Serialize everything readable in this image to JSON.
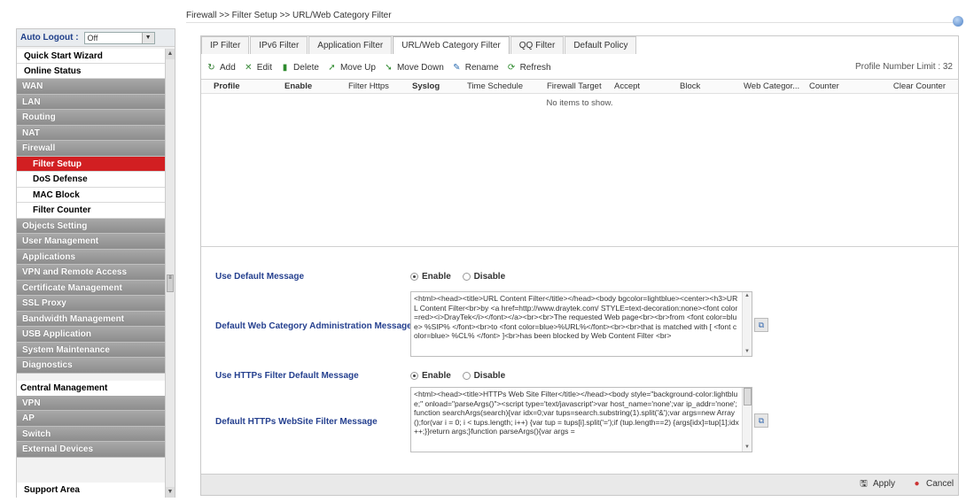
{
  "breadcrumb": "Firewall >> Filter Setup >> URL/Web Category Filter",
  "sidebar": {
    "auto_logout_label": "Auto Logout :",
    "auto_logout_value": "Off",
    "menu": [
      {
        "label": "Quick Start Wizard",
        "style": "top"
      },
      {
        "label": "Online Status",
        "style": "top"
      },
      {
        "label": "WAN",
        "style": "dark"
      },
      {
        "label": "LAN",
        "style": "dark"
      },
      {
        "label": "Routing",
        "style": "dark"
      },
      {
        "label": "NAT",
        "style": "dark"
      },
      {
        "label": "Firewall",
        "style": "dark"
      },
      {
        "label": "Filter Setup",
        "style": "sub-active"
      },
      {
        "label": "DoS Defense",
        "style": "sub"
      },
      {
        "label": "MAC Block",
        "style": "sub"
      },
      {
        "label": "Filter Counter",
        "style": "sub"
      },
      {
        "label": "Objects Setting",
        "style": "dark"
      },
      {
        "label": "User Management",
        "style": "dark"
      },
      {
        "label": "Applications",
        "style": "dark"
      },
      {
        "label": "VPN and Remote Access",
        "style": "dark"
      },
      {
        "label": "Certificate Management",
        "style": "dark"
      },
      {
        "label": "SSL Proxy",
        "style": "dark"
      },
      {
        "label": "Bandwidth Management",
        "style": "dark"
      },
      {
        "label": "USB Application",
        "style": "dark"
      },
      {
        "label": "System Maintenance",
        "style": "dark"
      },
      {
        "label": "Diagnostics",
        "style": "dark"
      },
      {
        "label": "Central Management",
        "style": "section"
      },
      {
        "label": "VPN",
        "style": "dark"
      },
      {
        "label": "AP",
        "style": "dark"
      },
      {
        "label": "Switch",
        "style": "dark"
      },
      {
        "label": "External Devices",
        "style": "dark"
      }
    ],
    "support_area": "Support Area"
  },
  "tabs": [
    {
      "label": "IP Filter",
      "active": false
    },
    {
      "label": "IPv6 Filter",
      "active": false
    },
    {
      "label": "Application Filter",
      "active": false
    },
    {
      "label": "URL/Web Category Filter",
      "active": true
    },
    {
      "label": "QQ Filter",
      "active": false
    },
    {
      "label": "Default Policy",
      "active": false
    }
  ],
  "toolbar": {
    "add": "Add",
    "edit": "Edit",
    "delete": "Delete",
    "move_up": "Move Up",
    "move_down": "Move Down",
    "rename": "Rename",
    "refresh": "Refresh",
    "profile_limit": "Profile Number Limit : 32"
  },
  "grid": {
    "columns": [
      "",
      "Profile",
      "Enable",
      "Filter Https",
      "Syslog",
      "Time Schedule",
      "Firewall Target",
      "Accept",
      "Block",
      "Web Categor...",
      "Counter",
      "Clear Counter"
    ],
    "empty_text": "No items to show."
  },
  "settings": {
    "use_default_message": {
      "label": "Use Default Message",
      "enable": "Enable",
      "disable": "Disable",
      "selected": "Enable"
    },
    "default_web_category_message": {
      "label": "Default Web Category Administration Message",
      "value": "<html><head><title>URL Content Filter</title></head><body bgcolor=lightblue><center><h3>URL Content Filter<br>by <a href=http://www.draytek.com/ STYLE=text-decoration:none><font color=red><i>DrayTek</i></font></a><br><br>The requested Web page<br><br>from <font color=blue> %SIP% </font><br>to <font color=blue>%URL%</font><br><br>that is matched with [ <font color=blue> %CL% </font> ]<br>has been blocked by Web Content Filter <br>"
    },
    "use_https_default_message": {
      "label": "Use HTTPs Filter Default Message",
      "enable": "Enable",
      "disable": "Disable",
      "selected": "Enable"
    },
    "default_https_message": {
      "label": "Default HTTPs WebSite Filter Message",
      "value": "<html><head><title>HTTPs Web Site Filter</title></head><body style=\"background-color:lightblue;\" onload=\"parseArgs()\"><script type='text/javascript'>var host_name='none';var ip_addr='none';function searchArgs(search){var idx=0;var tups=search.substring(1).split('&');var args=new Array();for(var i = 0; i < tups.length; i++) {var tup = tups[i].split('=');if (tup.length==2) {args[idx]=tup[1];idx++;}}return args;}function parseArgs(){var args ="
    }
  },
  "footer": {
    "apply": "Apply",
    "cancel": "Cancel"
  },
  "colors": {
    "active_menu": "#d21f22",
    "menu_dark": "#9a9a9a",
    "form_label": "#25408f"
  }
}
